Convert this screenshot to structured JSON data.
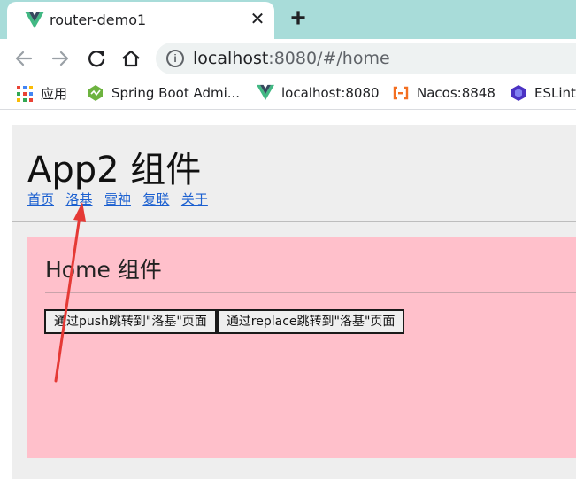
{
  "browser": {
    "tab": {
      "title": "router-demo1",
      "close": "✕"
    },
    "new_tab": "+",
    "address": {
      "host": "localhost",
      "rest": ":8080/#/home"
    },
    "bookmarks": [
      {
        "label": "应用",
        "icon": "apps-grid-icon"
      },
      {
        "label": "Spring Boot Admi...",
        "icon": "spring-boot-admin-icon"
      },
      {
        "label": "localhost:8080",
        "icon": "vue-logo-icon"
      },
      {
        "label": "Nacos:8848",
        "icon": "nacos-icon"
      },
      {
        "label": "ESLint",
        "icon": "eslint-icon"
      }
    ]
  },
  "page": {
    "title": "App2 组件",
    "nav": [
      "首页",
      "洛基",
      "雷神",
      "复联",
      "关于"
    ],
    "home": {
      "title": "Home 组件",
      "buttons": [
        "通过push跳转到\"洛基\"页面",
        "通过replace跳转到\"洛基\"页面"
      ]
    }
  },
  "colors": {
    "tab_strip": "#a8dcd9",
    "home_panel": "#ffc0cb",
    "link": "#1a5fd0",
    "annotation_arrow": "#e53935"
  }
}
